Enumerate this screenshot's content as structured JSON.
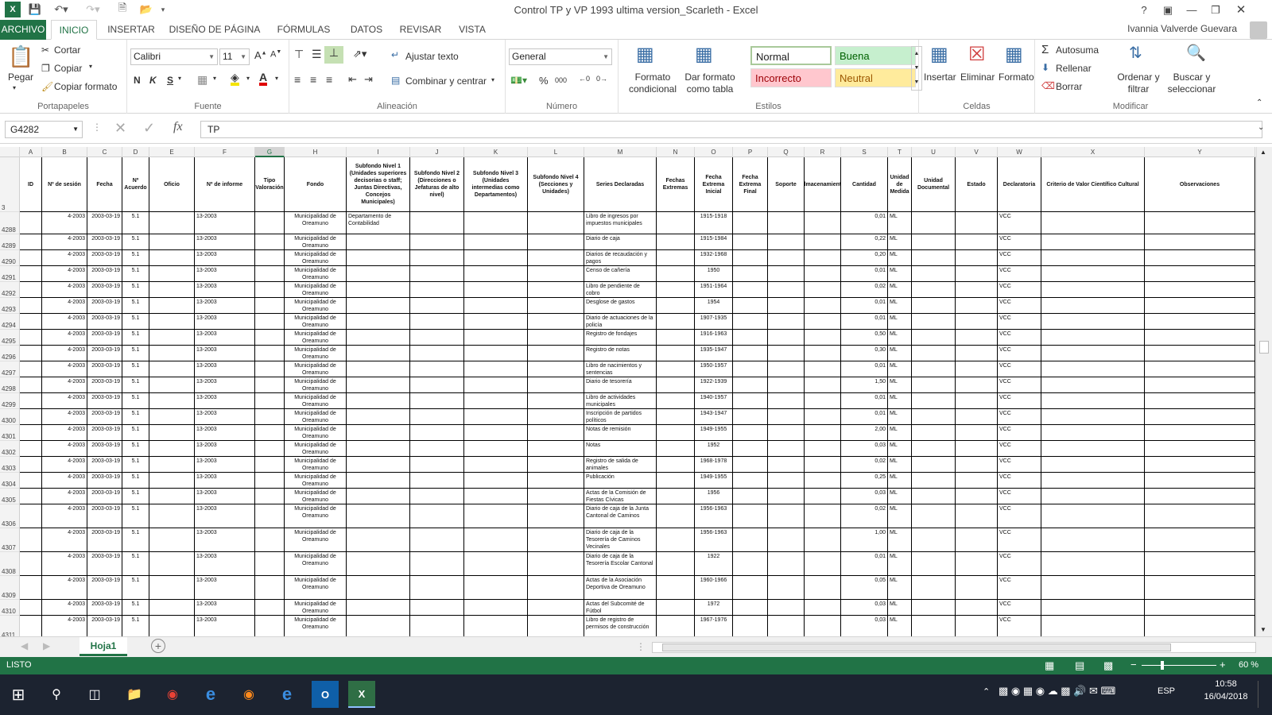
{
  "window": {
    "title": "Control TP y VP 1993 ultima version_Scarleth - Excel"
  },
  "tabs": [
    "ARCHIVO",
    "INICIO",
    "INSERTAR",
    "DISEÑO DE PÁGINA",
    "FÓRMULAS",
    "DATOS",
    "REVISAR",
    "VISTA"
  ],
  "user": "Ivannia Valverde Guevara",
  "ribbon": {
    "clipboard": {
      "paste": "Pegar",
      "cut": "Cortar",
      "copy": "Copiar",
      "format_painter": "Copiar formato",
      "label": "Portapapeles"
    },
    "font": {
      "name": "Calibri",
      "size": "11",
      "label": "Fuente"
    },
    "alignment": {
      "wrap": "Ajustar texto",
      "merge": "Combinar y centrar",
      "label": "Alineación"
    },
    "number": {
      "format": "General",
      "label": "Número"
    },
    "styles": {
      "cond": "Formato condicional",
      "table": "Dar formato como tabla",
      "normal": "Normal",
      "good": "Buena",
      "bad": "Incorrecto",
      "neutral": "Neutral",
      "label": "Estilos"
    },
    "cells": {
      "insert": "Insertar",
      "delete": "Eliminar",
      "format": "Formato",
      "label": "Celdas"
    },
    "editing": {
      "autosum": "Autosuma",
      "fill": "Rellenar",
      "clear": "Borrar",
      "sort": "Ordenar y filtrar",
      "find": "Buscar y seleccionar",
      "label": "Modificar"
    }
  },
  "formula_bar": {
    "cell": "G4282",
    "value": "TP"
  },
  "columns": [
    "A",
    "B",
    "C",
    "D",
    "E",
    "F",
    "G",
    "H",
    "I",
    "J",
    "K",
    "L",
    "M",
    "N",
    "O",
    "P",
    "Q",
    "R",
    "S",
    "T",
    "U",
    "V",
    "W",
    "X",
    "Y"
  ],
  "header_row": {
    "num": "3",
    "cells": [
      "ID",
      "Nº de sesión",
      "Fecha",
      "Nº Acuerdo",
      "Oficio",
      "Nº de informe",
      "Tipo Valoración",
      "Fondo",
      "Subfondo Nivel 1 (Unidades superiores decisorias o staff; Juntas Directivas, Concejos Municipales)",
      "Subfondo Nivel 2 (Direcciones o Jefaturas de alto nivel)",
      "Subfondo Nivel 3 (Unidades intermedias como Departamentos)",
      "Subfondo Nivel 4 (Secciones y Unidades)",
      "Series Declaradas",
      "Fechas Extremas",
      "Fecha Extrema Inicial",
      "Fecha Extrema Final",
      "Soporte",
      "Almacenamiento",
      "Cantidad",
      "Unidad de Medida",
      "Unidad Documental",
      "Estado",
      "Declaratoria",
      "Criterio de Valor Científico Cultural",
      "Observaciones"
    ]
  },
  "rows": [
    {
      "num": "4288",
      "sub1": "Departamento de Contabilidad",
      "serie": "Libro de ingresos por impuestos municipales",
      "fi": "1915-1918",
      "cant": "0,01"
    },
    {
      "num": "4289",
      "sub1": "",
      "serie": "Diario de caja",
      "fi": "1915-1984",
      "cant": "0,22"
    },
    {
      "num": "4290",
      "sub1": "",
      "serie": "Diarios de recaudación y pagos",
      "fi": "1932-1968",
      "cant": "0,20"
    },
    {
      "num": "4291",
      "sub1": "",
      "serie": "Censo de cañería",
      "fi": "1950",
      "cant": "0,01"
    },
    {
      "num": "4292",
      "sub1": "",
      "serie": "Libro de pendiente de cobro",
      "fi": "1951-1964",
      "cant": "0,02"
    },
    {
      "num": "4293",
      "sub1": "",
      "serie": "Desglose de gastos",
      "fi": "1954",
      "cant": "0,01"
    },
    {
      "num": "4294",
      "sub1": "",
      "serie": "Diario de actuaciones de la policía",
      "fi": "1907-1935",
      "cant": "0,01"
    },
    {
      "num": "4295",
      "sub1": "",
      "serie": "Registro de fondajes",
      "fi": "1916-1963",
      "cant": "0,50"
    },
    {
      "num": "4296",
      "sub1": "",
      "serie": "Registro de notas",
      "fi": "1935-1947",
      "cant": "0,30"
    },
    {
      "num": "4297",
      "sub1": "",
      "serie": "Libro de nacimientos y sentencias",
      "fi": "1950-1957",
      "cant": "0,01"
    },
    {
      "num": "4298",
      "sub1": "",
      "serie": "Diario de tesorería",
      "fi": "1922-1939",
      "cant": "1,50"
    },
    {
      "num": "4299",
      "sub1": "",
      "serie": "Libro de actividades municipales",
      "fi": "1940-1957",
      "cant": "0,01"
    },
    {
      "num": "4300",
      "sub1": "",
      "serie": "Inscripción de partidos políticos",
      "fi": "1943-1947",
      "cant": "0,01"
    },
    {
      "num": "4301",
      "sub1": "",
      "serie": "Notas de remisión",
      "fi": "1949-1955",
      "cant": "2,00"
    },
    {
      "num": "4302",
      "sub1": "",
      "serie": "Notas",
      "fi": "1952",
      "cant": "0,03"
    },
    {
      "num": "4303",
      "sub1": "",
      "serie": "Registro de salida de animales",
      "fi": "1968-1978",
      "cant": "0,02"
    },
    {
      "num": "4304",
      "sub1": "",
      "serie": "Publicación",
      "fi": "1949-1955",
      "cant": "0,25"
    },
    {
      "num": "4305",
      "sub1": "",
      "serie": "Actas de la Comisión de Fiestas Cívicas",
      "fi": "1956",
      "cant": "0,03"
    },
    {
      "num": "4306",
      "sub1": "",
      "serie": "Diario de caja de la Junta Cantonal de Caminos",
      "fi": "1956-1963",
      "cant": "0,02"
    },
    {
      "num": "4307",
      "sub1": "",
      "serie": "Diario de caja de la Tesorería de Caminos Vecinales",
      "fi": "1956-1963",
      "cant": "1,00"
    },
    {
      "num": "4308",
      "sub1": "",
      "serie": "Diario de caja de la Tesorería Escolar Cantonal",
      "fi": "1922",
      "cant": "0,01"
    },
    {
      "num": "4309",
      "sub1": "",
      "serie": "Actas de la Asociación Deportiva de Oreamuno",
      "fi": "1960-1966",
      "cant": "0,05"
    },
    {
      "num": "4310",
      "sub1": "",
      "serie": "Actas del Subcomité de Fútbol",
      "fi": "1972",
      "cant": "0,03"
    },
    {
      "num": "4311",
      "sub1": "",
      "serie": "Libro de registro de permisos de construcción",
      "fi": "1967-1976",
      "cant": "0,03"
    }
  ],
  "common": {
    "sesion": "4-2003",
    "fecha": "2003-03-19",
    "acuerdo": "5.1",
    "informe": "13-2003",
    "fondo": "Municipalidad de Oreamuno",
    "unidad": "ML",
    "decl": "VCC"
  },
  "sheet": {
    "name": "Hoja1"
  },
  "status": {
    "mode": "LISTO",
    "zoom": "60 %"
  },
  "taskbar": {
    "lang": "ESP",
    "time": "10:58",
    "date": "16/04/2018"
  }
}
